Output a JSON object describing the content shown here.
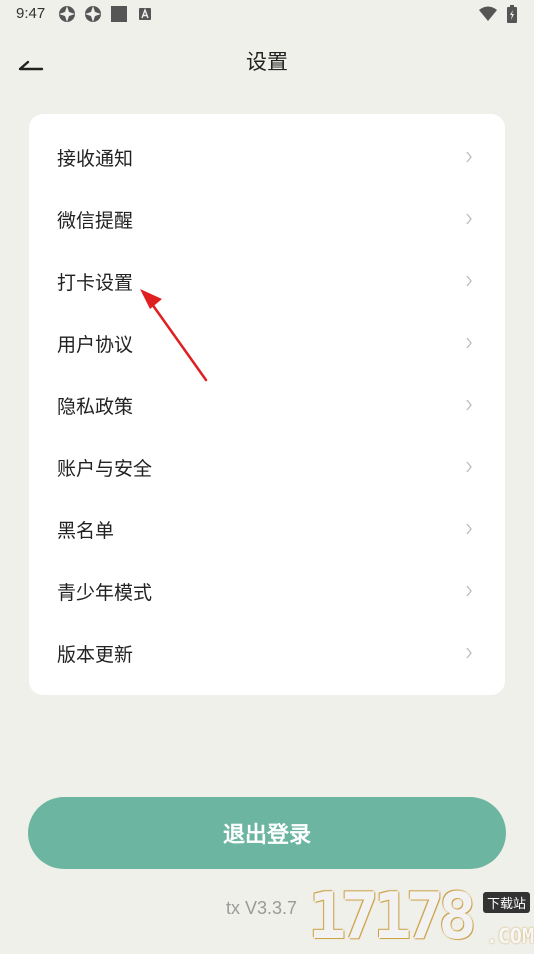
{
  "status_bar": {
    "time": "9:47",
    "left_icons": [
      "app-notification-icon",
      "app-notification-icon",
      "square-icon",
      "a-box-icon"
    ],
    "right_icons": [
      "wifi-icon",
      "battery-icon"
    ]
  },
  "header": {
    "title": "设置"
  },
  "menu": {
    "items": [
      {
        "label": "接收通知"
      },
      {
        "label": "微信提醒"
      },
      {
        "label": "打卡设置"
      },
      {
        "label": "用户协议"
      },
      {
        "label": "隐私政策"
      },
      {
        "label": "账户与安全"
      },
      {
        "label": "黑名单"
      },
      {
        "label": "青少年模式"
      },
      {
        "label": "版本更新"
      }
    ]
  },
  "logout": {
    "label": "退出登录"
  },
  "version": {
    "text": "tx V3.3.7"
  },
  "watermark": {
    "digits": "17178",
    "badge": "下载站",
    "suffix": ".COM"
  },
  "colors": {
    "background": "#f0f0eb",
    "card": "#ffffff",
    "accent": "#6cb6a1",
    "annotation": "#e02020"
  }
}
